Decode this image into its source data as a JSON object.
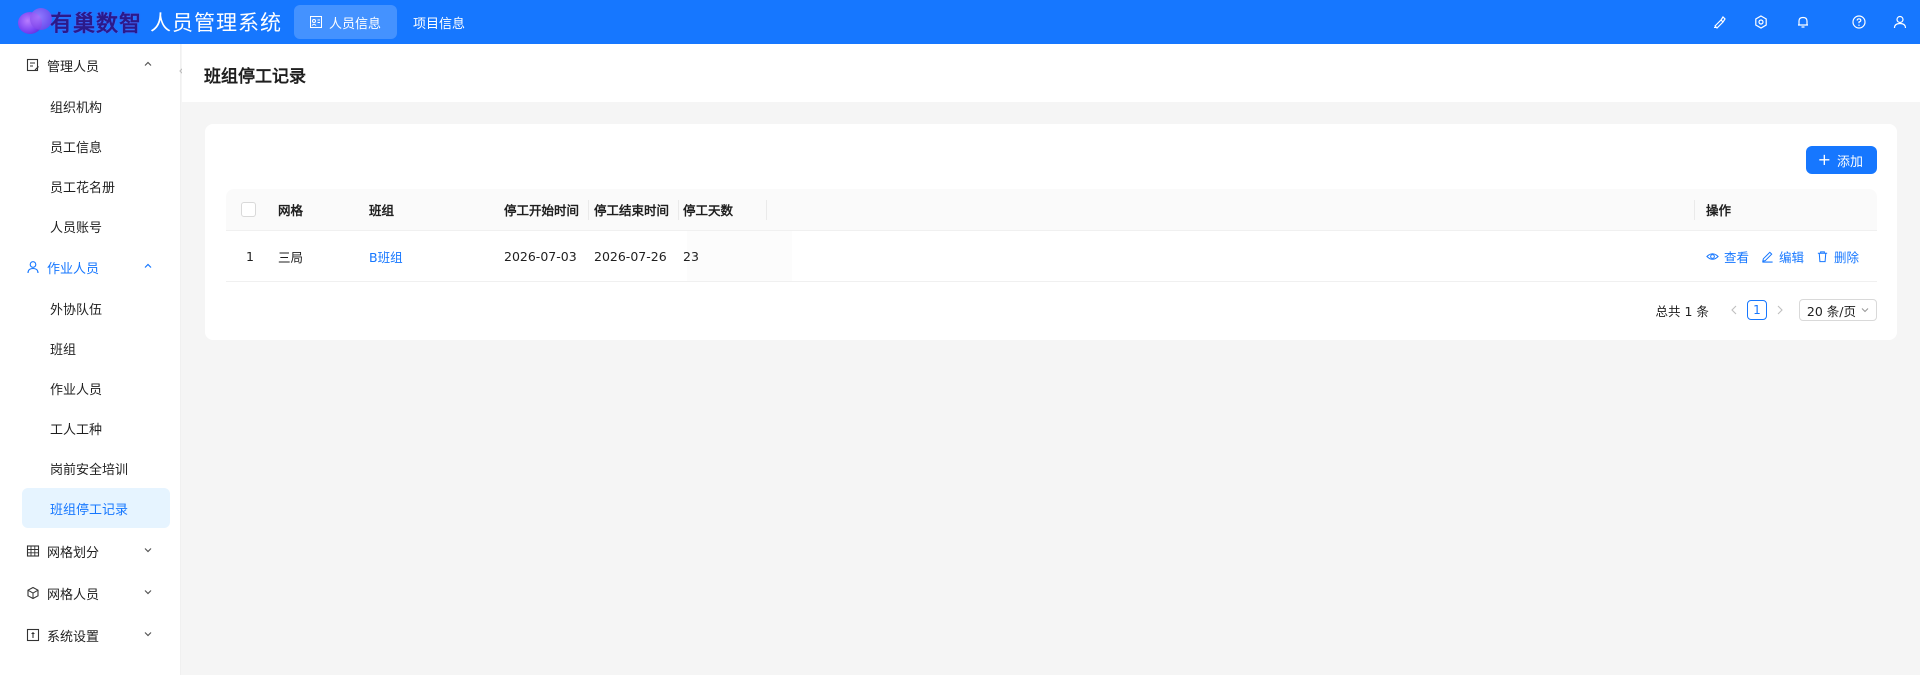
{
  "header": {
    "brand": "有巢数智",
    "system_title": "人员管理系统",
    "tabs": [
      {
        "label": "人员信息",
        "active": true
      },
      {
        "label": "项目信息",
        "active": false
      }
    ],
    "actions": [
      "brush-icon",
      "gear-icon",
      "bell-icon",
      "help-icon",
      "user-icon"
    ],
    "accent_color": "#1677ff"
  },
  "sidebar": {
    "groups": [
      {
        "label": "管理人员",
        "icon": "form-icon",
        "expanded": true,
        "items": [
          "组织机构",
          "员工信息",
          "员工花名册",
          "人员账号"
        ]
      },
      {
        "label": "作业人员",
        "icon": "user-icon",
        "expanded": true,
        "items": [
          "外协队伍",
          "班组",
          "作业人员",
          "工人工种",
          "岗前安全培训",
          "班组停工记录"
        ]
      },
      {
        "label": "网格划分",
        "icon": "table-icon",
        "expanded": false,
        "items": []
      },
      {
        "label": "网格人员",
        "icon": "cube-icon",
        "expanded": false,
        "items": []
      },
      {
        "label": "系统设置",
        "icon": "setting-box-icon",
        "expanded": false,
        "items": []
      }
    ],
    "selected_item": "班组停工记录"
  },
  "page": {
    "title": "班组停工记录",
    "add_button": "添加"
  },
  "table": {
    "columns": [
      "网格",
      "班组",
      "停工开始时间",
      "停工结束时间",
      "停工天数",
      "操作"
    ],
    "rows": [
      {
        "index": "1",
        "grid": "三局",
        "team": "B班组",
        "start": "2026-07-03",
        "end": "2026-07-26",
        "days": "23"
      }
    ],
    "actions": [
      "查看",
      "编辑",
      "删除"
    ]
  },
  "pagination": {
    "total_text": "总共 1 条",
    "current_page": "1",
    "page_size": "20 条/页"
  }
}
